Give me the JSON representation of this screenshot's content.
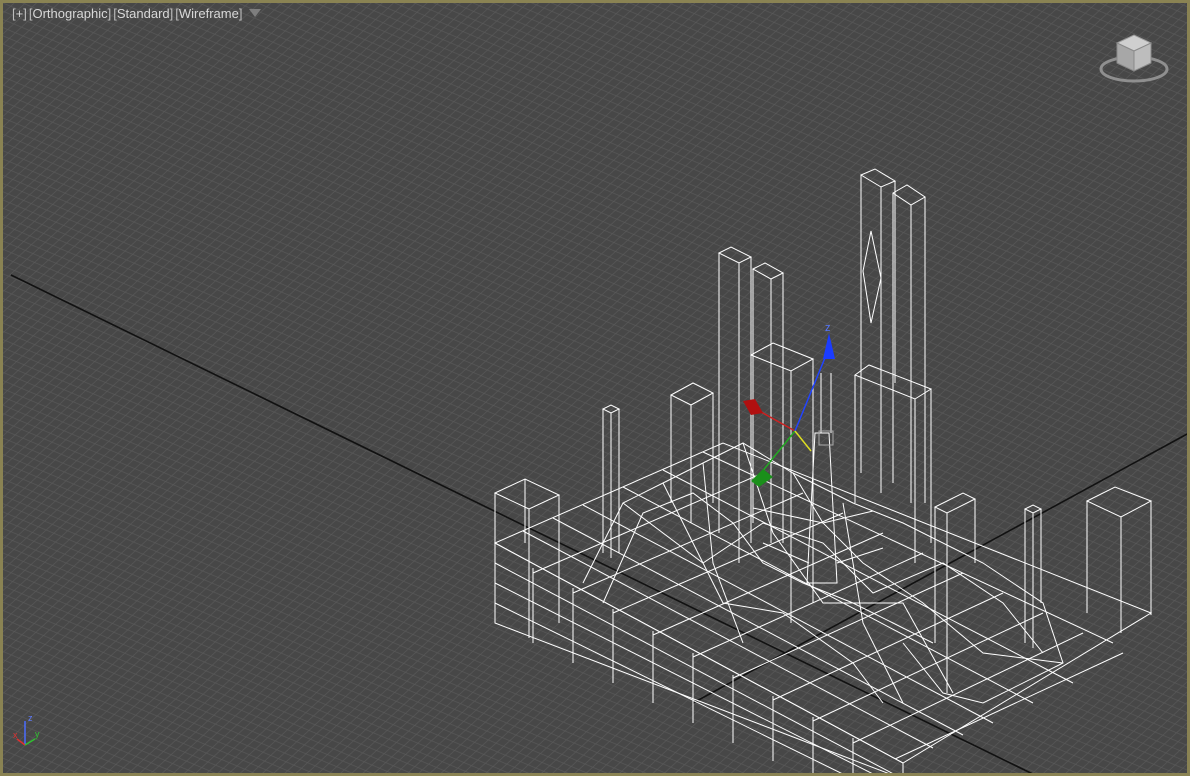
{
  "viewport": {
    "labels": {
      "plus": "+",
      "projection": "Orthographic",
      "shading_mode": "Standard",
      "display_mode": "Wireframe"
    },
    "axis_tripod": {
      "x": "x",
      "y": "y",
      "z": "z"
    },
    "gizmo_axis_label": "z",
    "active_border_color": "#8a8353",
    "background_color": "#474747",
    "grid_color": "#595959",
    "wireframe_color": "#ffffff"
  }
}
